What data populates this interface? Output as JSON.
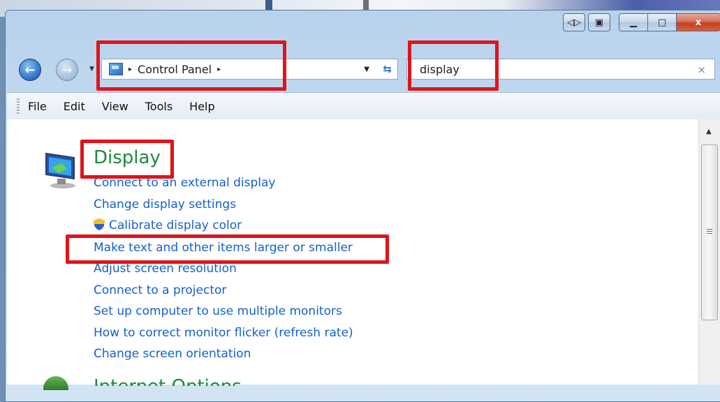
{
  "window": {
    "caption": {
      "close_glyph": "x"
    }
  },
  "nav": {
    "back_glyph": "←",
    "forward_glyph": "→",
    "address": {
      "crumb": "Control Panel",
      "arrow": "▸"
    },
    "search": {
      "value": "display",
      "clear_glyph": "×"
    }
  },
  "menu": {
    "items": [
      "File",
      "Edit",
      "View",
      "Tools",
      "Help"
    ]
  },
  "display_section": {
    "title": "Display",
    "links": [
      "Connect to an external display",
      "Change display settings",
      "Calibrate display color",
      "Make text and other items larger or smaller",
      "Adjust screen resolution",
      "Connect to a projector",
      "Set up computer to use multiple monitors",
      "How to correct monitor flicker (refresh rate)",
      "Change screen orientation"
    ]
  },
  "next_section": {
    "title": "Internet Options"
  },
  "colors": {
    "highlight": "#e0141a",
    "link": "#1560c9",
    "title": "#1e8a3a"
  }
}
